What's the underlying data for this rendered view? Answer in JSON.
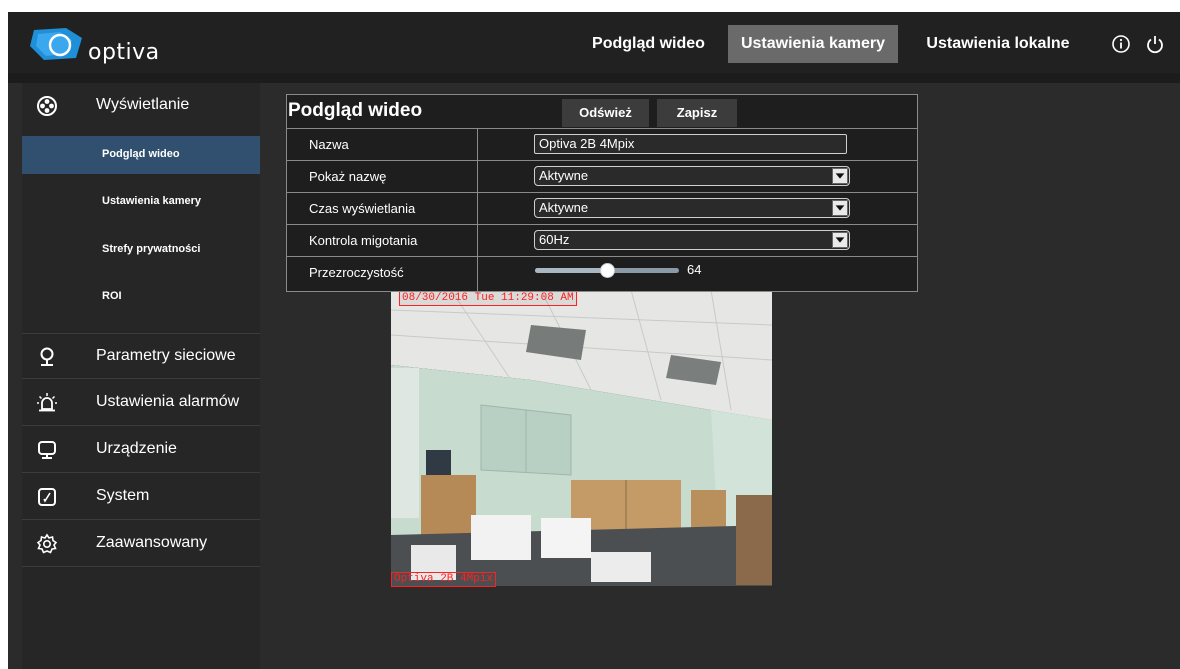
{
  "brand": {
    "logo_text": "optiva",
    "accent": "#1f8fd8"
  },
  "topnav": {
    "items": [
      {
        "label": "Podgląd wideo",
        "active": false
      },
      {
        "label": "Ustawienia kamery",
        "active": true
      },
      {
        "label": "Ustawienia lokalne",
        "active": false
      }
    ],
    "icons": [
      "info-icon",
      "power-icon"
    ]
  },
  "sidebar": {
    "sections": [
      {
        "label": "Wyświetlanie",
        "icon": "display-icon"
      },
      {
        "label": "Parametry sieciowe",
        "icon": "location-pin-icon"
      },
      {
        "label": "Ustawienia alarmów",
        "icon": "alarm-light-icon"
      },
      {
        "label": "Urządzenie",
        "icon": "monitor-icon"
      },
      {
        "label": "System",
        "icon": "system-icon"
      },
      {
        "label": "Zaawansowany",
        "icon": "gear-icon"
      }
    ],
    "subitems": [
      {
        "label": "Podgląd wideo",
        "active": true
      },
      {
        "label": "Ustawienia kamery",
        "active": false
      },
      {
        "label": "Strefy prywatności",
        "active": false
      },
      {
        "label": "ROI",
        "active": false
      }
    ]
  },
  "panel": {
    "title": "Podgląd wideo",
    "refresh_label": "Odśwież",
    "save_label": "Zapisz",
    "rows": [
      {
        "label": "Nazwa",
        "value": "Optiva 2B 4Mpix",
        "type": "text"
      },
      {
        "label": "Pokaż nazwę",
        "value": "Aktywne",
        "type": "select"
      },
      {
        "label": "Czas wyświetlania",
        "value": "Aktywne",
        "type": "select"
      },
      {
        "label": "Kontrola migotania",
        "value": "60Hz",
        "type": "select"
      },
      {
        "label": "Przezroczystość",
        "value": "64",
        "type": "slider",
        "fraction": 0.5
      }
    ]
  },
  "video": {
    "osd_time": "08/30/2016 Tue 11:29:08 AM",
    "osd_name": "Optiva 2B 4Mpix"
  }
}
